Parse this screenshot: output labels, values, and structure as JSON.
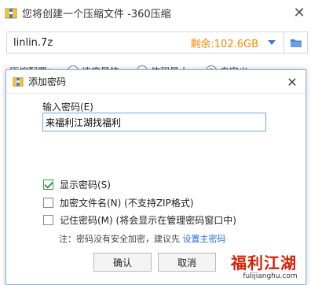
{
  "background_window": {
    "title": "您将创建一个压缩文件 -360压缩",
    "path": "linlin.7z",
    "free_space": "剩余:102.6GB",
    "config_label": "压缩配置：",
    "config_options": [
      "速度最快",
      "体积最小",
      "自定义"
    ],
    "side_label": "X"
  },
  "dialog": {
    "title": "添加密码",
    "password_label": "输入密码(E)",
    "password_value": "来福利江湖找福利",
    "checkboxes": [
      {
        "label": "显示密码(S)",
        "checked": true
      },
      {
        "label": "加密文件名(N)  (不支持ZIP格式)",
        "checked": false
      },
      {
        "label": "记住密码(M)  (将会显示在管理密码窗口中)",
        "checked": false
      }
    ],
    "note_text": "注：密码没有安全加密，建议先 ",
    "note_link": "设置主密码",
    "ok_label": "确认",
    "cancel_label": "取消"
  },
  "watermark": {
    "main": "福利江湖",
    "sub": "fulijianghu.com"
  },
  "colors": {
    "accent": "#3a7bd5",
    "free_space": "#f08a00",
    "watermark": "#d81e06",
    "check": "#3a9a4a"
  }
}
